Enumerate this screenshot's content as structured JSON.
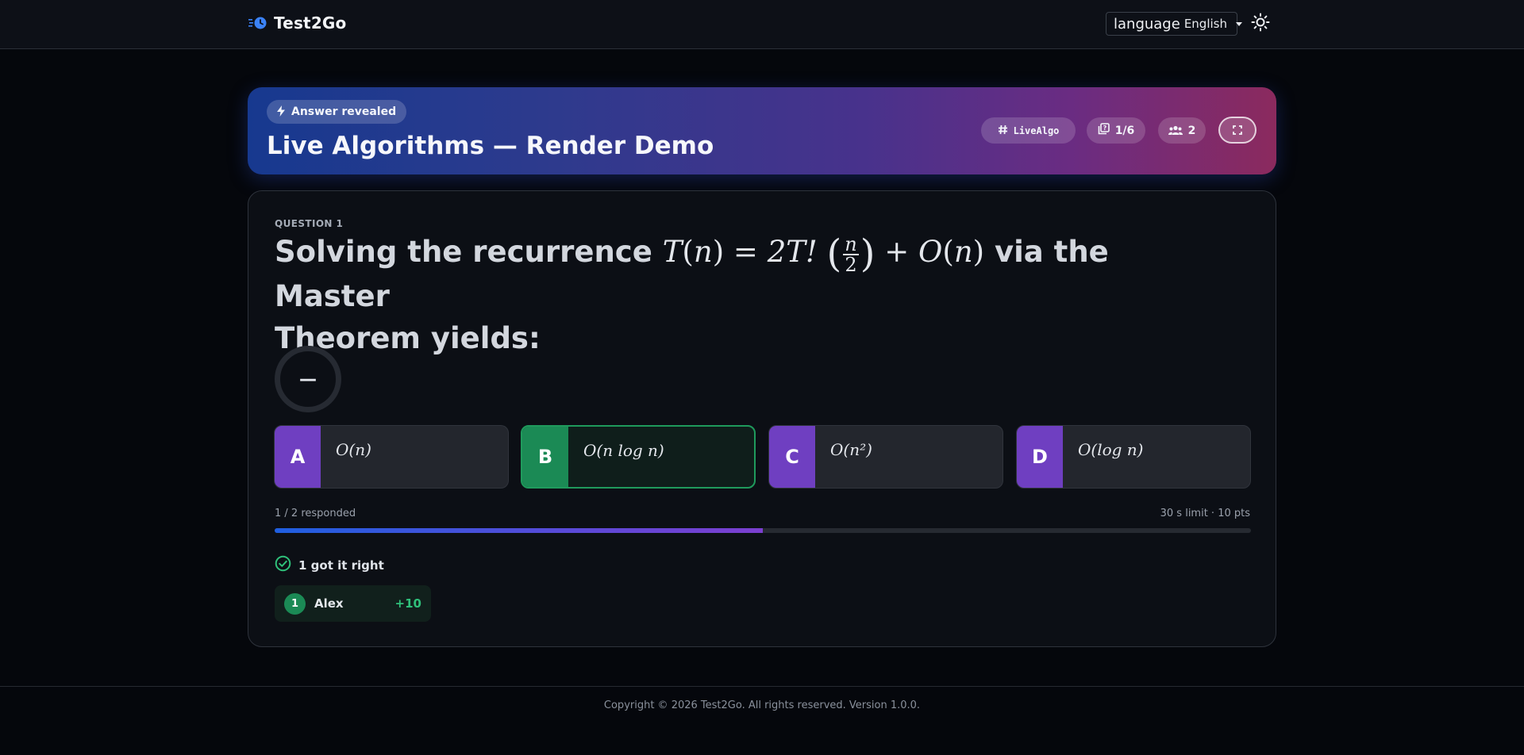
{
  "navbar": {
    "brand_name": "Test2Go",
    "language_label": "language",
    "language_value": "English",
    "icons": {
      "logo": "stopwatch-logo-icon",
      "theme": "sun-icon",
      "caret": "caret-down-icon"
    }
  },
  "hero": {
    "status_pill": "Answer revealed",
    "title": "Live Algorithms — Render Demo",
    "room_code": "LiveAlgo",
    "question_counter": "1/6",
    "participants": "2",
    "colors": {
      "gradient_start": "#17398f",
      "gradient_end": "#8b2a5e"
    }
  },
  "question": {
    "label": "QUESTION 1",
    "text_before": "Solving the recurrence",
    "math": {
      "T": "T",
      "n": "n",
      "eq": "=",
      "twoT": "2T!",
      "frac_num": "n",
      "frac_den": "2",
      "plus": "+",
      "O": "O"
    },
    "text_after": "via the Master",
    "text_line2": "Theorem yields:",
    "timer": "—",
    "options": [
      {
        "letter": "A",
        "text": "O(n)",
        "correct": false
      },
      {
        "letter": "B",
        "text": "O(n log n)",
        "correct": true
      },
      {
        "letter": "C",
        "text": "O(n²)",
        "correct": false
      },
      {
        "letter": "D",
        "text": "O(log n)",
        "correct": false
      }
    ],
    "responded": "1 / 2 responded",
    "limit": "30 s limit · 10 pts",
    "progress_fraction": 0.5,
    "got_it_right": "1 got it right",
    "leaderboard": [
      {
        "rank": "1",
        "name": "Alex",
        "points": "+10"
      }
    ],
    "colors": {
      "option_letter": "#6f3fc1",
      "correct": "#1b8a55",
      "points": "#2fc07a"
    }
  },
  "footer": {
    "copyright": "Copyright © 2026 Test2Go. All rights reserved. Version 1.0.0."
  }
}
